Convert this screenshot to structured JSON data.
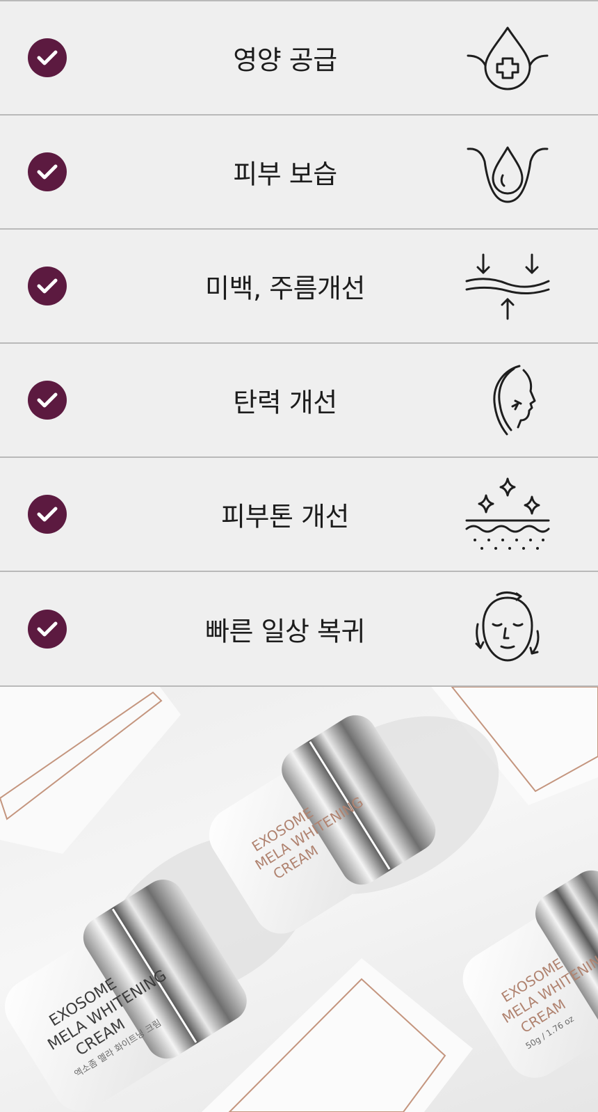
{
  "colors": {
    "check_bg": "#5c1a40",
    "check_mark": "#ffffff",
    "icon_stroke": "#1e1e1e",
    "divider": "#b9b9b9",
    "row_bg": "#efefef",
    "product_accent": "#c4957e"
  },
  "benefits": [
    {
      "label": "영양 공급",
      "icon": "nutrition-drop-plus-icon"
    },
    {
      "label": "피부 보습",
      "icon": "moisture-drop-icon"
    },
    {
      "label": "미백, 주름개선",
      "icon": "skin-compression-arrows-icon"
    },
    {
      "label": "탄력 개선",
      "icon": "face-lift-profile-icon"
    },
    {
      "label": "피부톤 개선",
      "icon": "sparkle-skin-tone-icon"
    },
    {
      "label": "빠른 일상 복귀",
      "icon": "face-recovery-cycle-icon"
    }
  ],
  "product": {
    "brand_line1": "EXOSOME",
    "brand_line2": "MELA WHITENING",
    "brand_line3": "CREAM",
    "korean_name": "엑소좀 멜라 화이트닝 크림",
    "volume": "50g / 1.76 oz"
  }
}
